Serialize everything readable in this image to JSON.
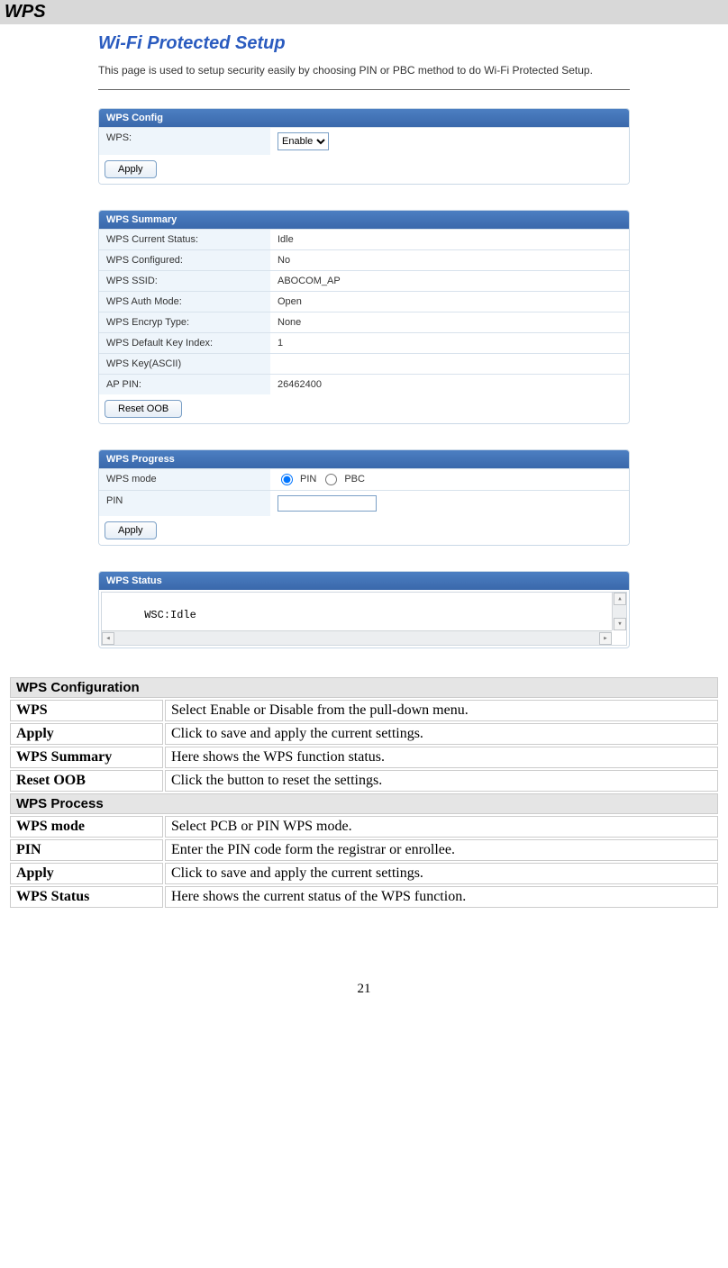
{
  "page": {
    "heading": "WPS",
    "number": "21"
  },
  "screenshot": {
    "title": "Wi-Fi Protected Setup",
    "description": "This page is used to setup security easily by choosing PIN or PBC method to do Wi-Fi Protected Setup.",
    "config_panel_header": "WPS Config",
    "config": {
      "wps_label": "WPS:",
      "wps_select": "Enable",
      "apply_button": "Apply"
    },
    "summary_panel_header": "WPS Summary",
    "summary": {
      "status_label": "WPS Current Status:",
      "status_value": "Idle",
      "configured_label": "WPS Configured:",
      "configured_value": "No",
      "ssid_label": "WPS SSID:",
      "ssid_value": "ABOCOM_AP",
      "auth_label": "WPS Auth Mode:",
      "auth_value": "Open",
      "encryp_label": "WPS Encryp Type:",
      "encryp_value": "None",
      "keyidx_label": "WPS Default Key Index:",
      "keyidx_value": "1",
      "key_label": "WPS Key(ASCII)",
      "key_value": "",
      "appin_label": "AP PIN:",
      "appin_value": "26462400",
      "reset_button": "Reset OOB"
    },
    "progress_panel_header": "WPS Progress",
    "progress": {
      "mode_label": "WPS mode",
      "pin_radio_label": "PIN",
      "pbc_radio_label": "PBC",
      "pin_label": "PIN",
      "pin_value": "",
      "apply_button": "Apply"
    },
    "status_panel_header": "WPS Status",
    "status_text": "WSC:Idle"
  },
  "desc": {
    "section_config": "WPS Configuration",
    "rows_config": [
      {
        "k": "WPS",
        "v": "Select Enable or Disable from the pull-down menu."
      },
      {
        "k": "Apply",
        "v": "Click to save and apply the current settings."
      },
      {
        "k": "WPS Summary",
        "v": "Here shows the WPS function status."
      },
      {
        "k": "Reset OOB",
        "v": "Click the button to reset the settings."
      }
    ],
    "section_process": "WPS Process",
    "rows_process": [
      {
        "k": "WPS mode",
        "v": "Select PCB or PIN WPS mode."
      },
      {
        "k": "PIN",
        "v": "Enter the PIN code form the registrar or enrollee."
      },
      {
        "k": "Apply",
        "v": "Click to save and apply the current settings."
      },
      {
        "k": "WPS Status",
        "v": "Here shows the current status of the WPS function."
      }
    ]
  }
}
